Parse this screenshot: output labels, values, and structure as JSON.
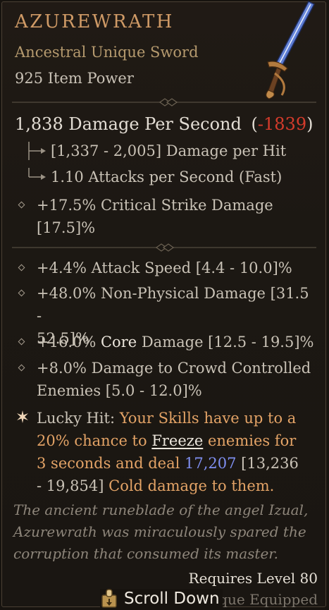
{
  "item": {
    "name": "AZUREWRATH",
    "type": "Ancestral Unique Sword",
    "power": "925 Item Power"
  },
  "dps": {
    "value": "1,838 Damage Per Second",
    "open": "(",
    "delta": "-1839",
    "close": ")",
    "lines": [
      "[1,337 - 2,005] Damage per Hit",
      "1.10 Attacks per Second (Fast)"
    ]
  },
  "implicit": {
    "line1": "+17.5% Critical Strike Damage",
    "line2": "[17.5]%"
  },
  "affixes": {
    "a1": "+4.4% Attack Speed [4.4 - 10.0]%",
    "a2_line1": "+48.0% Non-Physical Damage [31.5 -",
    "a2_line2": "52.5]%",
    "a3_pre": "+16.0% ",
    "a3_core": "Core",
    "a3_post": " Damage [12.5 - 19.5]%",
    "a4_line1": "+8.0% Damage to Crowd Controlled",
    "a4_line2": "Enemies [5.0 - 12.0]%"
  },
  "lucky": {
    "label": "Lucky Hit:",
    "t1": " Your Skills have up to a 20% chance to ",
    "freeze": "Freeze",
    "t2": " enemies for 3 seconds and deal ",
    "value": "17,207",
    "range": " [13,236 - 19,854]",
    "t3": " Cold damage to them."
  },
  "flavor": "The ancient runeblade of the angel Izual, Azurewrath was miraculously spared the corruption that consumed its master.",
  "footer": {
    "requires": "Requires Level 80",
    "equipped": "Unique Equipped",
    "scroll": "Scroll Down"
  },
  "icons": {
    "sword": "sword-icon",
    "diamond": "diamond-bullet-icon",
    "star": "lucky-hit-star-icon",
    "scroll": "scroll-key-icon"
  },
  "colors": {
    "title": "#cf9a66",
    "unique_orange": "#e3a366",
    "negative": "#d43b2b",
    "blue_value": "#7f8ff0"
  }
}
